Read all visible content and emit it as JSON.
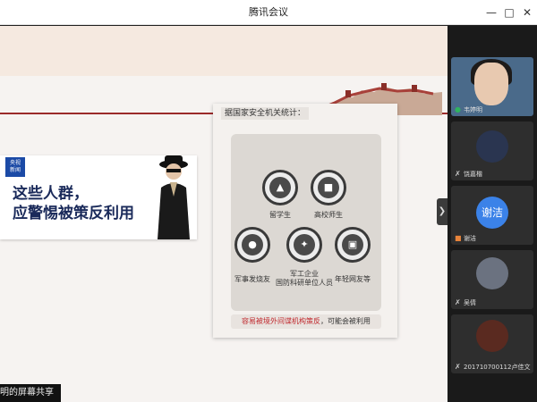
{
  "window": {
    "title": "腾讯会议",
    "minimize_icon": "minimize-icon",
    "maximize_icon": "maximize-icon",
    "close_icon": "close-icon"
  },
  "share": {
    "caption": "明的屏幕共享",
    "news": {
      "logo": "央视\n新闻",
      "headline_line1": "这些人群，",
      "headline_line2": "应警惕被策反利用"
    },
    "stats": {
      "source_label": "据国家安全机关统计：",
      "groups": [
        {
          "label": "留学生",
          "icon": "graduate-icon"
        },
        {
          "label": "高校师生",
          "icon": "teacher-icon"
        },
        {
          "label": "军事发烧友",
          "icon": "binoculars-icon"
        },
        {
          "label": "军工企业\n国防科研单位人员",
          "icon": "aircraft-icon"
        },
        {
          "label": "年轻网友等",
          "icon": "computer-user-icon"
        }
      ],
      "warning_red": "容易被境外间谍机构策反",
      "warning_black": "，可能会被利用"
    }
  },
  "participants": [
    {
      "name": "韦婷明",
      "mic": "active"
    },
    {
      "name": "饶嘉楷",
      "mic": "muted"
    },
    {
      "name": "谢洁",
      "avatar_text": "谢洁",
      "mic": "user"
    },
    {
      "name": "吴倩",
      "mic": "muted"
    },
    {
      "name": "201710700112卢佳文",
      "mic": "muted"
    }
  ],
  "colors": {
    "accent_red": "#c0282d",
    "xiejie_avatar": "#3b82e8",
    "mic_active": "#2fb35f"
  }
}
